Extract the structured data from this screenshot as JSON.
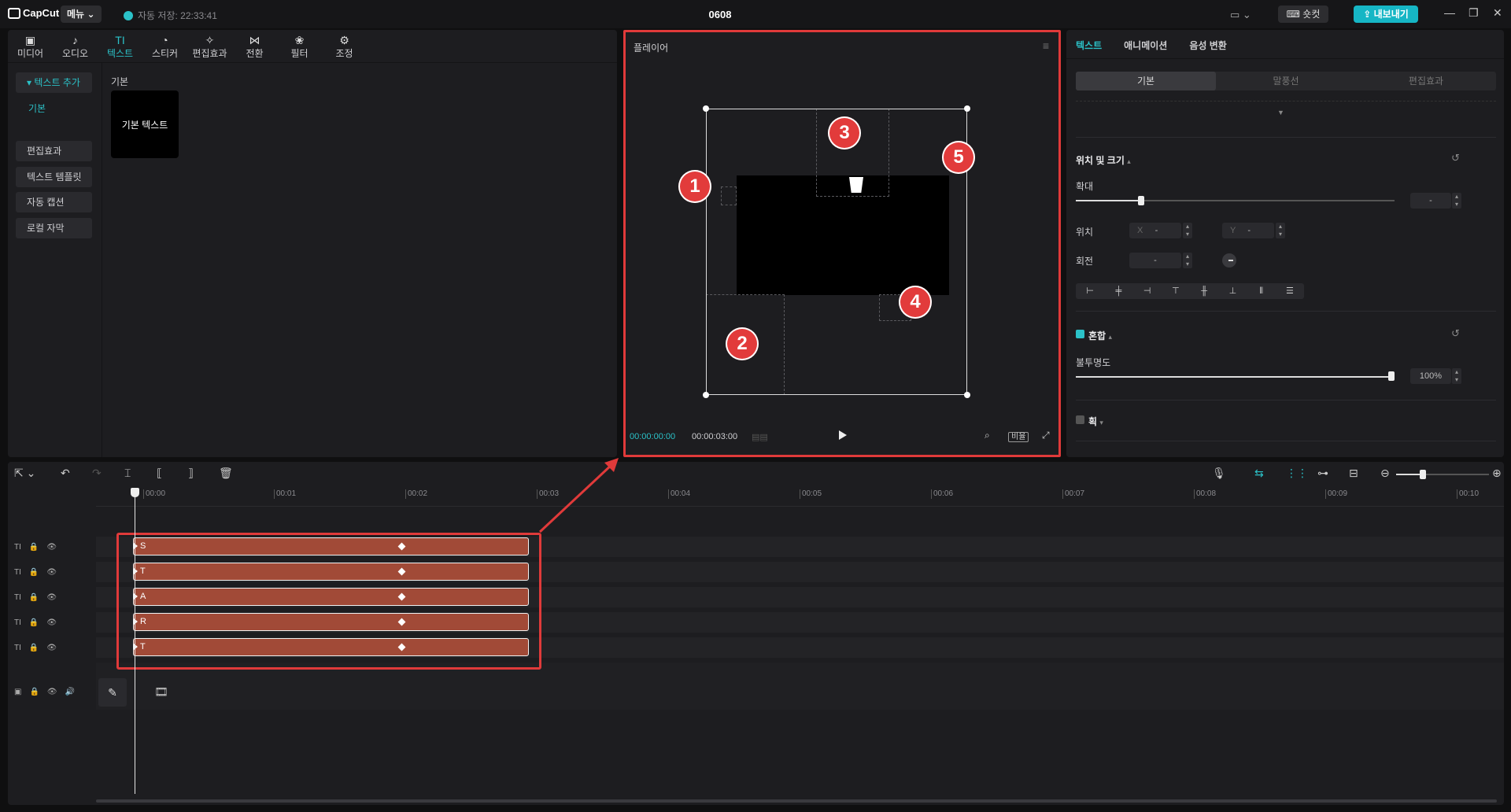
{
  "app": {
    "logo": "CapCut",
    "menu_label": "메뉴",
    "autosave": "자동 저장: 22:33:41",
    "project_title": "0608",
    "shortcut_label": "숏컷",
    "export_label": "내보내기"
  },
  "tool_tabs": [
    {
      "label": "미디어",
      "icon": "▣"
    },
    {
      "label": "오디오",
      "icon": "♪"
    },
    {
      "label": "텍스트",
      "icon": "TI"
    },
    {
      "label": "스티커",
      "icon": "◔"
    },
    {
      "label": "편집효과",
      "icon": "✧"
    },
    {
      "label": "전환",
      "icon": "⋈"
    },
    {
      "label": "필터",
      "icon": "❀"
    },
    {
      "label": "조정",
      "icon": "⚙"
    }
  ],
  "side_nav": {
    "add_text": "텍스트 추가",
    "basic": "기본",
    "effects": "편집효과",
    "template": "텍스트 템플릿",
    "auto_caption": "자동 캡션",
    "local_caption": "로컬 자막"
  },
  "library": {
    "heading": "기본",
    "card_label": "기본 텍스트"
  },
  "player": {
    "title": "플레이어",
    "current_time": "00:00:00:00",
    "total_time": "00:00:03:00",
    "ratio_label": "비율",
    "badges": [
      "1",
      "2",
      "3",
      "4",
      "5"
    ]
  },
  "inspector": {
    "tabs": [
      "텍스트",
      "애니메이션",
      "음성 변환"
    ],
    "segments": [
      "기본",
      "말풍선",
      "편집효과"
    ],
    "position_size": "위치 및 크기",
    "scale_label": "확대",
    "scale_value": "-",
    "position_label": "위치",
    "x_label": "X",
    "x_value": "-",
    "y_label": "Y",
    "y_value": "-",
    "rotation_label": "회전",
    "rotation_value": "-",
    "blend_label": "혼합",
    "opacity_label": "불투명도",
    "opacity_value": "100%",
    "stroke_label": "획"
  },
  "timeline": {
    "ticks": [
      "00:00",
      "00:01",
      "00:02",
      "00:03",
      "00:04",
      "00:05",
      "00:06",
      "00:07",
      "00:08",
      "00:09",
      "00:10"
    ],
    "clips": [
      "S",
      "T",
      "A",
      "R",
      "T"
    ]
  },
  "colors": {
    "accent": "#2bc2c8",
    "highlight": "#e03a3a",
    "clip": "#a14a37"
  }
}
